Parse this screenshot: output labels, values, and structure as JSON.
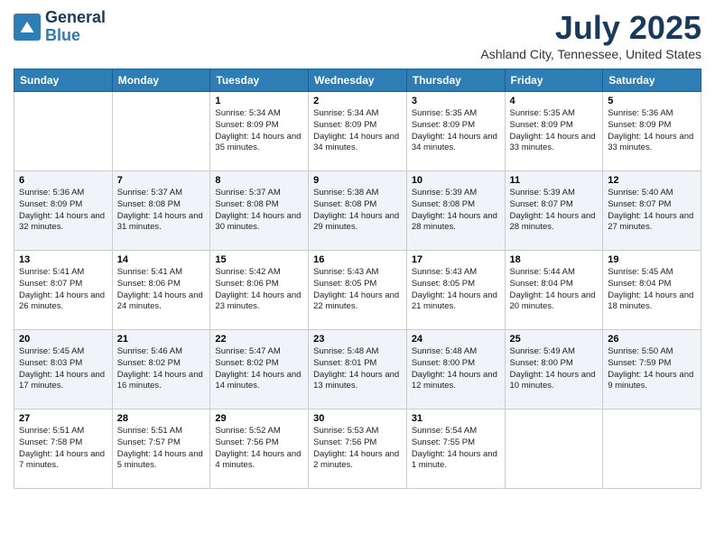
{
  "header": {
    "logo_line1": "General",
    "logo_line2": "Blue",
    "month_title": "July 2025",
    "location": "Ashland City, Tennessee, United States"
  },
  "days_of_week": [
    "Sunday",
    "Monday",
    "Tuesday",
    "Wednesday",
    "Thursday",
    "Friday",
    "Saturday"
  ],
  "weeks": [
    [
      {
        "day": "",
        "empty": true
      },
      {
        "day": "",
        "empty": true
      },
      {
        "day": "1",
        "sunrise": "5:34 AM",
        "sunset": "8:09 PM",
        "daylight": "14 hours and 35 minutes."
      },
      {
        "day": "2",
        "sunrise": "5:34 AM",
        "sunset": "8:09 PM",
        "daylight": "14 hours and 34 minutes."
      },
      {
        "day": "3",
        "sunrise": "5:35 AM",
        "sunset": "8:09 PM",
        "daylight": "14 hours and 34 minutes."
      },
      {
        "day": "4",
        "sunrise": "5:35 AM",
        "sunset": "8:09 PM",
        "daylight": "14 hours and 33 minutes."
      },
      {
        "day": "5",
        "sunrise": "5:36 AM",
        "sunset": "8:09 PM",
        "daylight": "14 hours and 33 minutes."
      }
    ],
    [
      {
        "day": "6",
        "sunrise": "5:36 AM",
        "sunset": "8:09 PM",
        "daylight": "14 hours and 32 minutes."
      },
      {
        "day": "7",
        "sunrise": "5:37 AM",
        "sunset": "8:08 PM",
        "daylight": "14 hours and 31 minutes."
      },
      {
        "day": "8",
        "sunrise": "5:37 AM",
        "sunset": "8:08 PM",
        "daylight": "14 hours and 30 minutes."
      },
      {
        "day": "9",
        "sunrise": "5:38 AM",
        "sunset": "8:08 PM",
        "daylight": "14 hours and 29 minutes."
      },
      {
        "day": "10",
        "sunrise": "5:39 AM",
        "sunset": "8:08 PM",
        "daylight": "14 hours and 28 minutes."
      },
      {
        "day": "11",
        "sunrise": "5:39 AM",
        "sunset": "8:07 PM",
        "daylight": "14 hours and 28 minutes."
      },
      {
        "day": "12",
        "sunrise": "5:40 AM",
        "sunset": "8:07 PM",
        "daylight": "14 hours and 27 minutes."
      }
    ],
    [
      {
        "day": "13",
        "sunrise": "5:41 AM",
        "sunset": "8:07 PM",
        "daylight": "14 hours and 26 minutes."
      },
      {
        "day": "14",
        "sunrise": "5:41 AM",
        "sunset": "8:06 PM",
        "daylight": "14 hours and 24 minutes."
      },
      {
        "day": "15",
        "sunrise": "5:42 AM",
        "sunset": "8:06 PM",
        "daylight": "14 hours and 23 minutes."
      },
      {
        "day": "16",
        "sunrise": "5:43 AM",
        "sunset": "8:05 PM",
        "daylight": "14 hours and 22 minutes."
      },
      {
        "day": "17",
        "sunrise": "5:43 AM",
        "sunset": "8:05 PM",
        "daylight": "14 hours and 21 minutes."
      },
      {
        "day": "18",
        "sunrise": "5:44 AM",
        "sunset": "8:04 PM",
        "daylight": "14 hours and 20 minutes."
      },
      {
        "day": "19",
        "sunrise": "5:45 AM",
        "sunset": "8:04 PM",
        "daylight": "14 hours and 18 minutes."
      }
    ],
    [
      {
        "day": "20",
        "sunrise": "5:45 AM",
        "sunset": "8:03 PM",
        "daylight": "14 hours and 17 minutes."
      },
      {
        "day": "21",
        "sunrise": "5:46 AM",
        "sunset": "8:02 PM",
        "daylight": "14 hours and 16 minutes."
      },
      {
        "day": "22",
        "sunrise": "5:47 AM",
        "sunset": "8:02 PM",
        "daylight": "14 hours and 14 minutes."
      },
      {
        "day": "23",
        "sunrise": "5:48 AM",
        "sunset": "8:01 PM",
        "daylight": "14 hours and 13 minutes."
      },
      {
        "day": "24",
        "sunrise": "5:48 AM",
        "sunset": "8:00 PM",
        "daylight": "14 hours and 12 minutes."
      },
      {
        "day": "25",
        "sunrise": "5:49 AM",
        "sunset": "8:00 PM",
        "daylight": "14 hours and 10 minutes."
      },
      {
        "day": "26",
        "sunrise": "5:50 AM",
        "sunset": "7:59 PM",
        "daylight": "14 hours and 9 minutes."
      }
    ],
    [
      {
        "day": "27",
        "sunrise": "5:51 AM",
        "sunset": "7:58 PM",
        "daylight": "14 hours and 7 minutes."
      },
      {
        "day": "28",
        "sunrise": "5:51 AM",
        "sunset": "7:57 PM",
        "daylight": "14 hours and 5 minutes."
      },
      {
        "day": "29",
        "sunrise": "5:52 AM",
        "sunset": "7:56 PM",
        "daylight": "14 hours and 4 minutes."
      },
      {
        "day": "30",
        "sunrise": "5:53 AM",
        "sunset": "7:56 PM",
        "daylight": "14 hours and 2 minutes."
      },
      {
        "day": "31",
        "sunrise": "5:54 AM",
        "sunset": "7:55 PM",
        "daylight": "14 hours and 1 minute."
      },
      {
        "day": "",
        "empty": true
      },
      {
        "day": "",
        "empty": true
      }
    ]
  ]
}
